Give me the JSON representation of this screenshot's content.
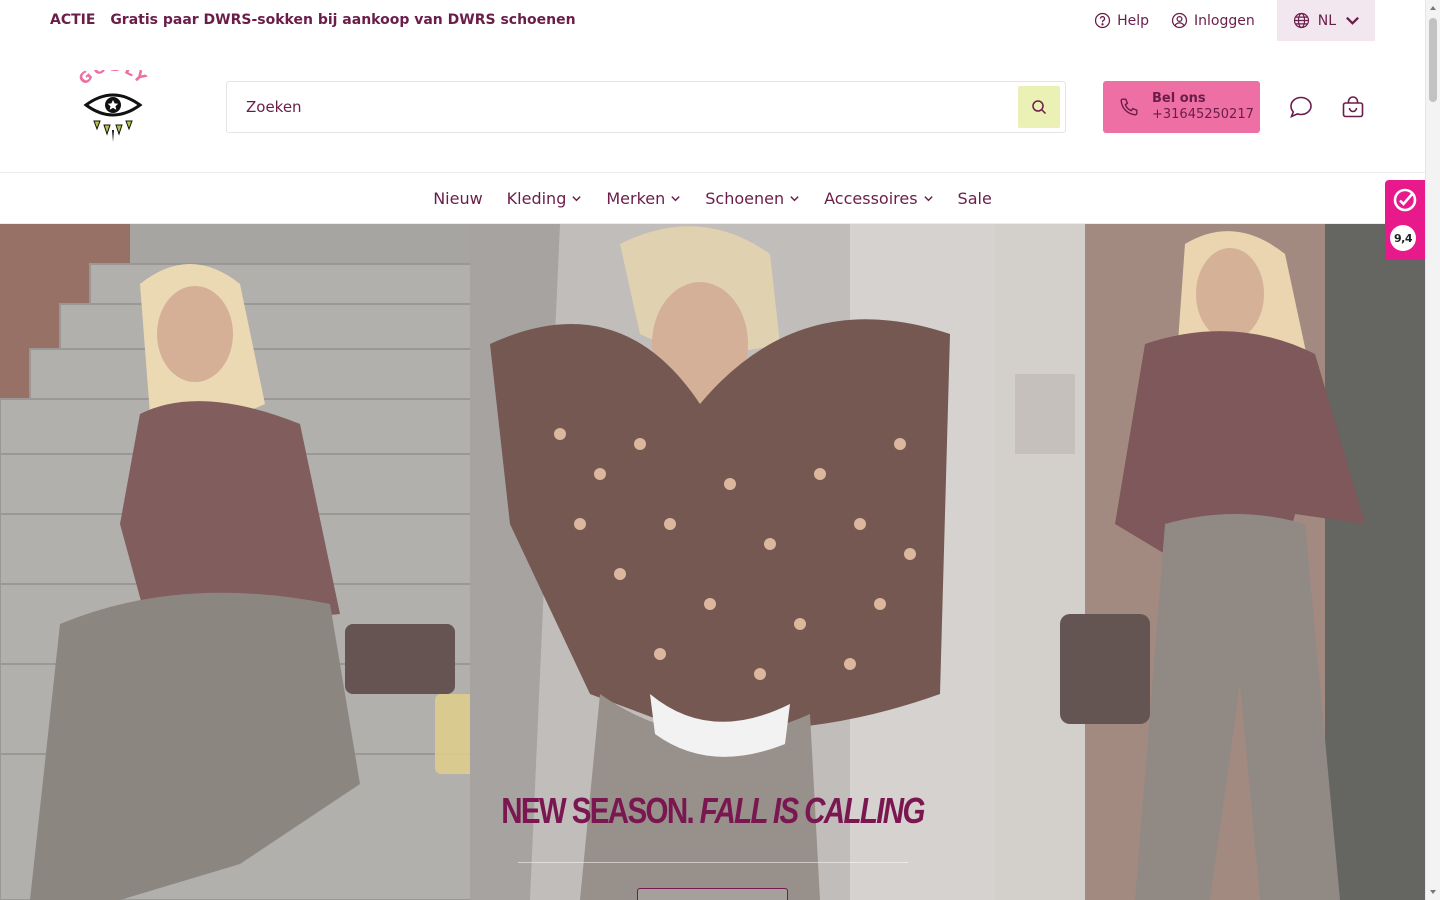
{
  "promo": {
    "tag": "ACTIE",
    "text": "Gratis paar DWRS-sokken bij aankoop van DWRS schoenen"
  },
  "toplinks": {
    "help": "Help",
    "login": "Inloggen",
    "language": "NL"
  },
  "header": {
    "logo_text": "GODLY",
    "search_placeholder": "Zoeken",
    "call_title": "Bel ons",
    "call_number": "+31645250217"
  },
  "nav": [
    {
      "label": "Nieuw",
      "dropdown": false
    },
    {
      "label": "Kleding",
      "dropdown": true
    },
    {
      "label": "Merken",
      "dropdown": true
    },
    {
      "label": "Schoenen",
      "dropdown": true
    },
    {
      "label": "Accessoires",
      "dropdown": true
    },
    {
      "label": "Sale",
      "dropdown": false
    }
  ],
  "hero": {
    "title_main": "NEW SEASON.",
    "title_accent": "FALL IS CALLING"
  },
  "review_widget": {
    "score": "9,4"
  },
  "colors": {
    "brand": "#6b1d4a",
    "pink": "#ee6fa3",
    "lime": "#ebf0b4",
    "review": "#e8198b"
  }
}
